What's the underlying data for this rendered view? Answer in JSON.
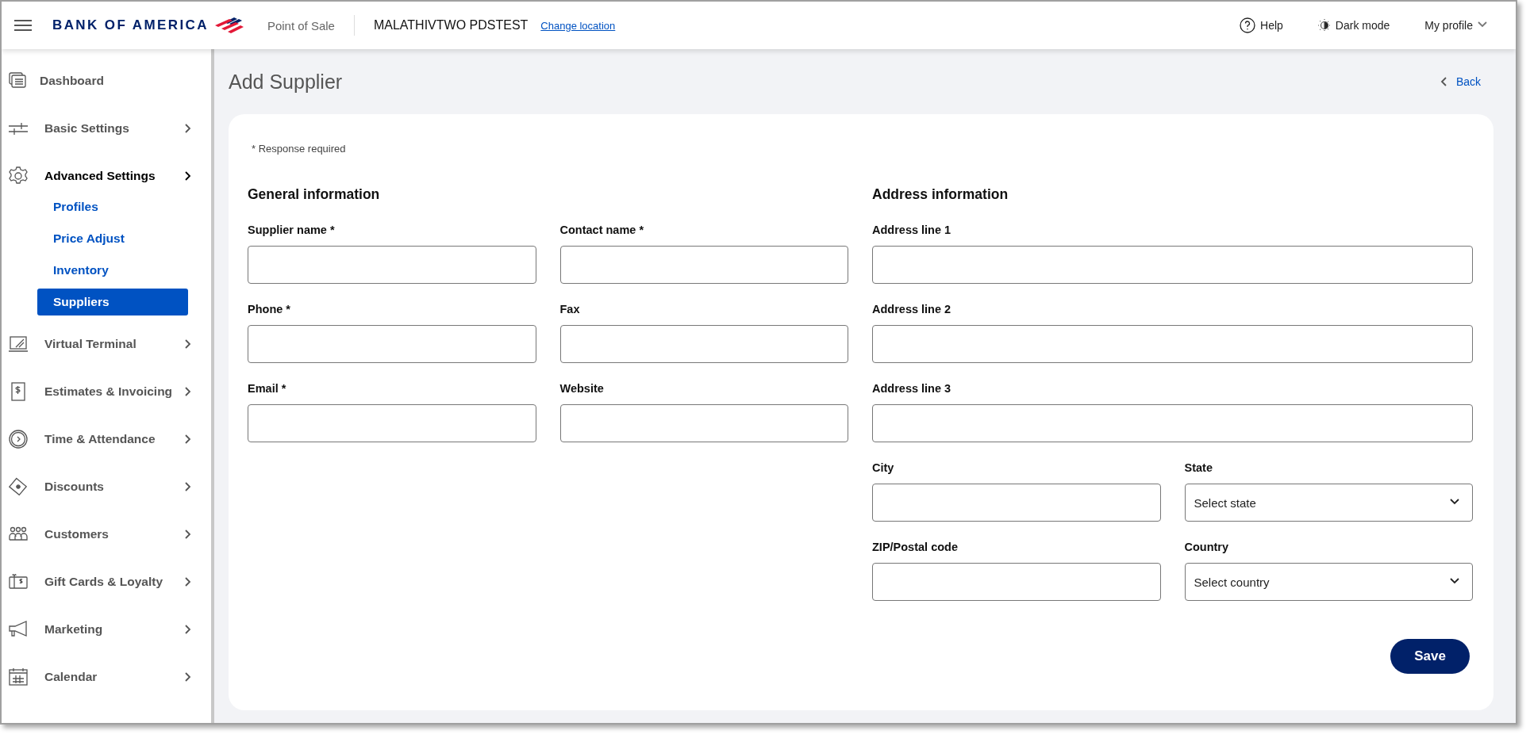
{
  "header": {
    "brand": "BANK OF AMERICA",
    "product": "Point of Sale",
    "location": "MALATHIVTWO PDSTEST",
    "change_location": "Change location",
    "help": "Help",
    "dark_mode": "Dark mode",
    "profile": "My profile"
  },
  "sidebar": {
    "items": [
      {
        "label": "Dashboard",
        "kind": "link",
        "expanded": false
      },
      {
        "label": "Basic Settings",
        "kind": "group",
        "expanded": false
      },
      {
        "label": "Advanced Settings",
        "kind": "group",
        "expanded": true,
        "children": [
          {
            "label": "Profiles",
            "selected": false
          },
          {
            "label": "Price Adjust",
            "selected": false
          },
          {
            "label": "Inventory",
            "selected": false
          },
          {
            "label": "Suppliers",
            "selected": true
          }
        ]
      },
      {
        "label": "Virtual Terminal",
        "kind": "group",
        "expanded": false
      },
      {
        "label": "Estimates & Invoicing",
        "kind": "group",
        "expanded": false
      },
      {
        "label": "Time & Attendance",
        "kind": "group",
        "expanded": false
      },
      {
        "label": "Discounts",
        "kind": "group",
        "expanded": false
      },
      {
        "label": "Customers",
        "kind": "group",
        "expanded": false
      },
      {
        "label": "Gift Cards & Loyalty",
        "kind": "group",
        "expanded": false
      },
      {
        "label": "Marketing",
        "kind": "group",
        "expanded": false
      },
      {
        "label": "Calendar",
        "kind": "group",
        "expanded": false
      }
    ]
  },
  "page": {
    "title": "Add Supplier",
    "back": "Back"
  },
  "form": {
    "required_note": "* Response required",
    "sections": [
      {
        "title": "General information",
        "fields": [
          {
            "label": "Supplier name *",
            "kind": "text"
          },
          {
            "label": "Contact name *",
            "kind": "text"
          },
          {
            "label": "Phone *",
            "kind": "text"
          },
          {
            "label": "Fax",
            "kind": "text"
          },
          {
            "label": "Email *",
            "kind": "text"
          },
          {
            "label": "Website",
            "kind": "text"
          }
        ]
      },
      {
        "title": "Address information",
        "fields": [
          {
            "label": "Address line 1",
            "kind": "wide-text"
          },
          {
            "label": "Address line 2",
            "kind": "wide-text"
          },
          {
            "label": "Address line 3",
            "kind": "wide-text"
          },
          {
            "label": "City",
            "kind": "text"
          },
          {
            "label": "State",
            "kind": "select",
            "placeholder": "Select state"
          },
          {
            "label": "ZIP/Postal code",
            "kind": "text"
          },
          {
            "label": "Country",
            "kind": "select",
            "placeholder": "Select country"
          }
        ]
      }
    ],
    "save": "Save"
  }
}
